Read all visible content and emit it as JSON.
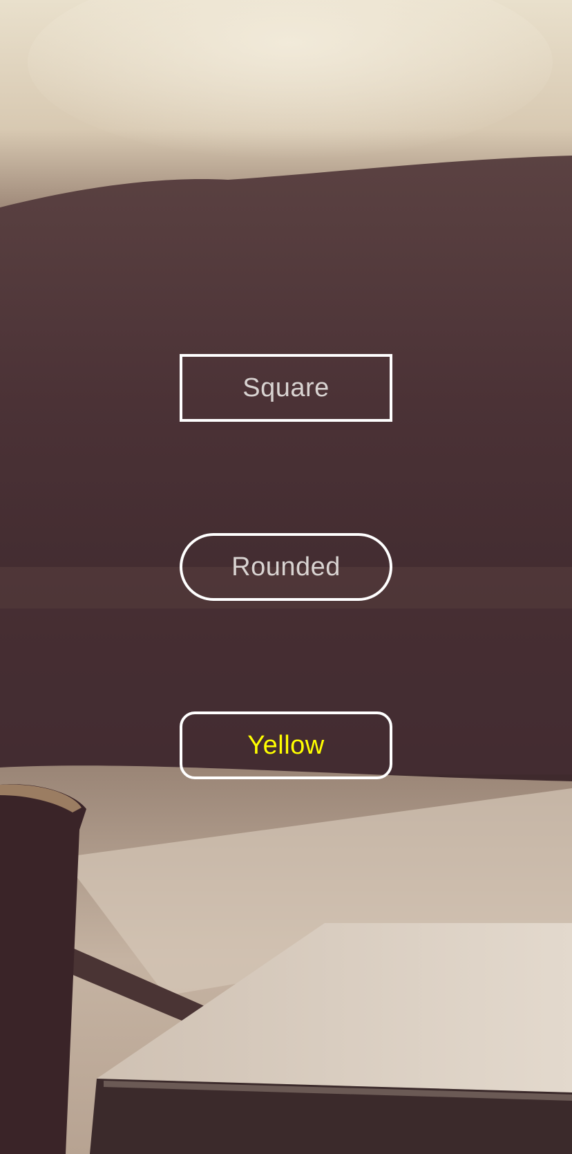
{
  "background": {
    "description_colors": {
      "top_highlight": "#e8dfce",
      "couch": "#4a3232",
      "table": "#c9b8a6",
      "dark": "#2f1f22"
    }
  },
  "buttons": {
    "square_label": "Square",
    "rounded_label": "Rounded",
    "yellow_label": "Yellow"
  },
  "colors": {
    "border": "#ffffff",
    "text_default": "#d8d3d1",
    "text_yellow": "#ffff00"
  }
}
